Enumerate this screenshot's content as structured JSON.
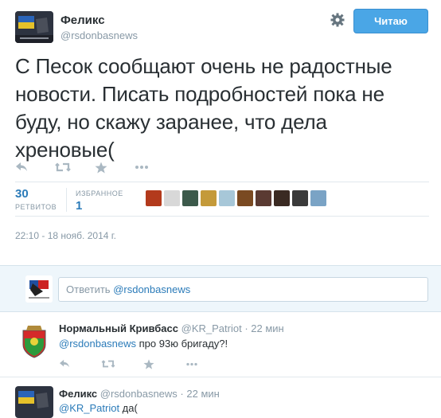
{
  "tweet": {
    "author_name": "Феликс",
    "author_handle": "@rsdonbasnews",
    "follow_label": "Читаю",
    "text": "С Песок сообщают очень не радостные новости. Писать подробностей пока не буду, но скажу заранее, что дела хреновые(",
    "retweets": {
      "count": "30",
      "label": "РЕТВИТОВ"
    },
    "favorites": {
      "count": "1",
      "label": "ИЗБРАННОЕ"
    },
    "timestamp": "22:10 - 18 нояб. 2014 г."
  },
  "favoriters_colors": [
    "#b33a1c",
    "#d8d8d8",
    "#3c5a4b",
    "#c49a3a",
    "#a7c7d8",
    "#7a4a22",
    "#5a3a32",
    "#3a2a22",
    "#3a3a3a",
    "#7aa3c5"
  ],
  "reply_box": {
    "prefix": "Ответить ",
    "mention": "@rsdonbasnews"
  },
  "replies": [
    {
      "name": "Нормальный Кривбасс",
      "handle": "@KR_Patriot",
      "time": "22 мин",
      "mention": "@rsdonbasnews",
      "text": " про 93ю бригаду?!"
    },
    {
      "name": "Феликс",
      "handle": "@rsdonbasnews",
      "time": "22 мин",
      "mention": "@KR_Patriot",
      "text": " да("
    }
  ],
  "colors": {
    "accent": "#4aa6e6",
    "link": "#2b7bb9",
    "muted": "#8899a6"
  }
}
